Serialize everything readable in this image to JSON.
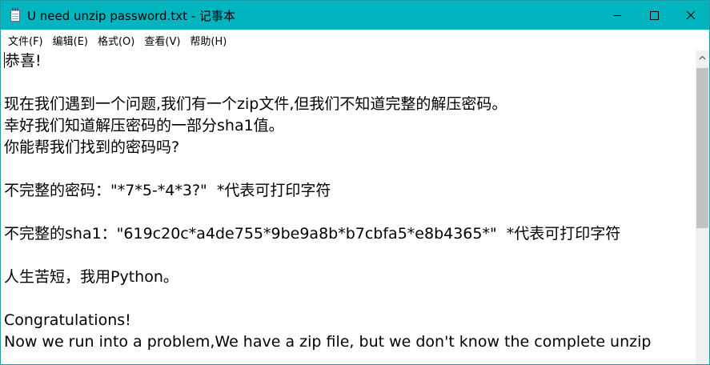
{
  "window": {
    "title": "U need unzip password.txt - 记事本"
  },
  "menu": {
    "items": [
      "文件(F)",
      "编辑(E)",
      "格式(O)",
      "查看(V)",
      "帮助(H)"
    ]
  },
  "editor": {
    "lines": [
      "恭喜!",
      "",
      "现在我们遇到一个问题,我们有一个zip文件,但我们不知道完整的解压密码。",
      "幸好我们知道解压密码的一部分sha1值。",
      "你能帮我们找到的密码吗?",
      "",
      "不完整的密码：\"*7*5-*4*3?\"  *代表可打印字符",
      "",
      "不完整的sha1：\"619c20c*a4de755*9be9a8b*b7cbfa5*e8b4365*\"  *代表可打印字符",
      "",
      "人生苦短，我用Python。",
      "",
      "Congratulations!",
      "Now we run into a problem,We have a zip file, but we don't know the complete unzip"
    ]
  },
  "icons": {
    "app": "notepad-icon",
    "minimize": "minimize-icon",
    "maximize": "maximize-icon",
    "close": "close-icon",
    "scroll_up": "chevron-up-icon"
  },
  "colors": {
    "titlebar": "#00b4c0",
    "scroll_thumb": "#c1c1c1"
  }
}
